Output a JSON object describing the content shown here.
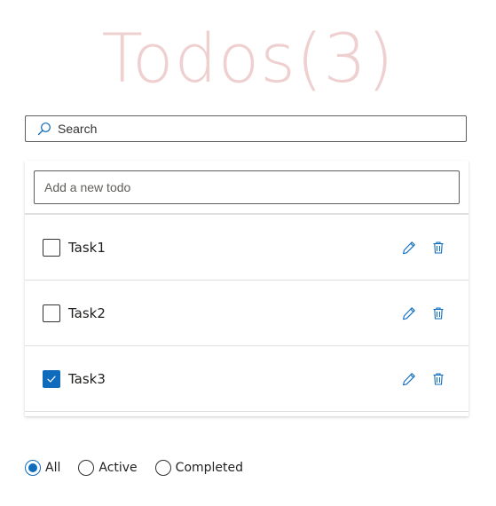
{
  "header": {
    "title": "Todos(3)"
  },
  "search": {
    "placeholder": "Search",
    "icon": "search-icon"
  },
  "add_todo": {
    "placeholder": "Add a new todo"
  },
  "todos": [
    {
      "label": "Task1",
      "checked": false
    },
    {
      "label": "Task2",
      "checked": false
    },
    {
      "label": "Task3",
      "checked": true
    }
  ],
  "filters": {
    "options": [
      "All",
      "Active",
      "Completed"
    ],
    "selected": "All"
  },
  "colors": {
    "accent": "#0f6cbd",
    "title": "#efd0d0"
  }
}
